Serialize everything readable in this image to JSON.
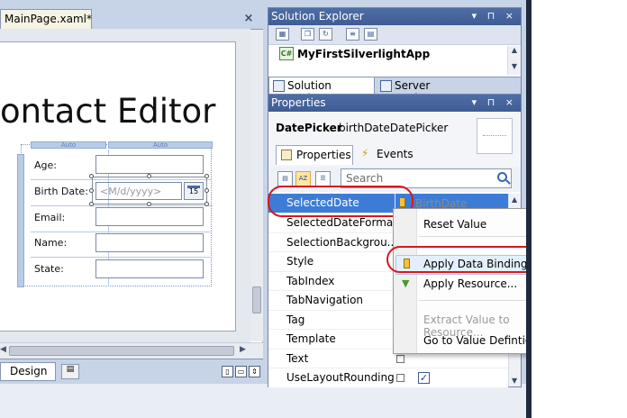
{
  "document": {
    "tab_label": "MainPage.xaml*",
    "close_glyph": "×",
    "heading_text": "ontact Editor",
    "ruler_labels": [
      "Auto",
      "Auto"
    ],
    "fields": [
      {
        "label": "Age:"
      },
      {
        "label": "Birth Date:"
      },
      {
        "label": "Email:"
      },
      {
        "label": "Name:"
      },
      {
        "label": "State:"
      }
    ],
    "datepicker_placeholder": "<M/d/yyyy>",
    "datepicker_day": "15",
    "view_tabs": {
      "design": "Design"
    }
  },
  "solution_explorer": {
    "title": "Solution Explorer",
    "title_buttons": "▾ ⊓ ×",
    "project_name": "MyFirstSilverlightApp",
    "tabs": [
      "Solution Explorer",
      "Server Explorer"
    ]
  },
  "properties": {
    "title": "Properties",
    "title_buttons": "▾ ⊓ ×",
    "element_type": "DatePicker",
    "element_name": "birthDateDatePicker",
    "tabs": {
      "properties": "Properties",
      "events": "Events"
    },
    "search_placeholder": "Search",
    "rows": [
      {
        "name": "SelectedDate",
        "value": "BirthDate"
      },
      {
        "name": "SelectedDateFormat",
        "value": ""
      },
      {
        "name": "SelectionBackgrou...",
        "value": ""
      },
      {
        "name": "Style",
        "value": ""
      },
      {
        "name": "TabIndex",
        "value": ""
      },
      {
        "name": "TabNavigation",
        "value": ""
      },
      {
        "name": "Tag",
        "value": ""
      },
      {
        "name": "Template",
        "value": ""
      },
      {
        "name": "Text",
        "value": ""
      },
      {
        "name": "UseLayoutRounding",
        "value": "✓"
      }
    ]
  },
  "context_menu": {
    "items": [
      {
        "label": "Reset Value",
        "enabled": true
      },
      {
        "label": "Apply Data Binding...",
        "enabled": true,
        "highlighted": true
      },
      {
        "label": "Apply Resource...",
        "enabled": true
      },
      {
        "label": "Extract Value to Resource...",
        "enabled": false
      },
      {
        "label": "Go to Value Defintion...",
        "enabled": true
      }
    ]
  },
  "colors": {
    "title_bar": "#3f5c92",
    "selected_row": "#3d7cd6",
    "highlight_oval": "#d9161f"
  }
}
